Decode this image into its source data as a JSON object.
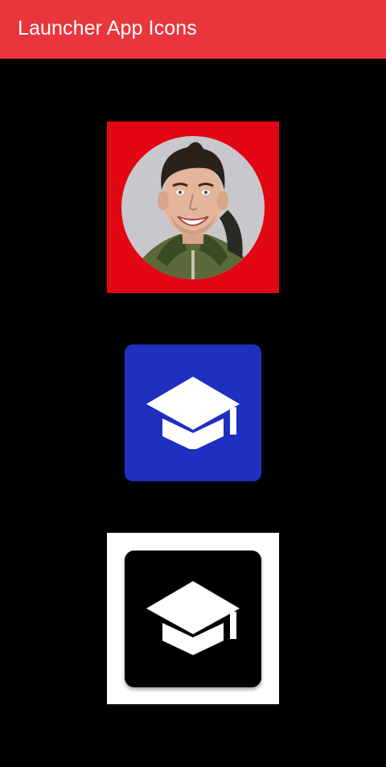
{
  "app_bar": {
    "title": "Launcher App Icons",
    "color": "#e8363c"
  },
  "icons": [
    {
      "name": "photo-avatar-icon",
      "background": "#e30613",
      "content": "person-photo"
    },
    {
      "name": "graduation-cap-icon",
      "background": "#1f2fbf",
      "glyph": "graduation-cap"
    },
    {
      "name": "graduation-cap-icon-dark",
      "background": "#000000",
      "frame": "#ffffff",
      "glyph": "graduation-cap"
    }
  ]
}
